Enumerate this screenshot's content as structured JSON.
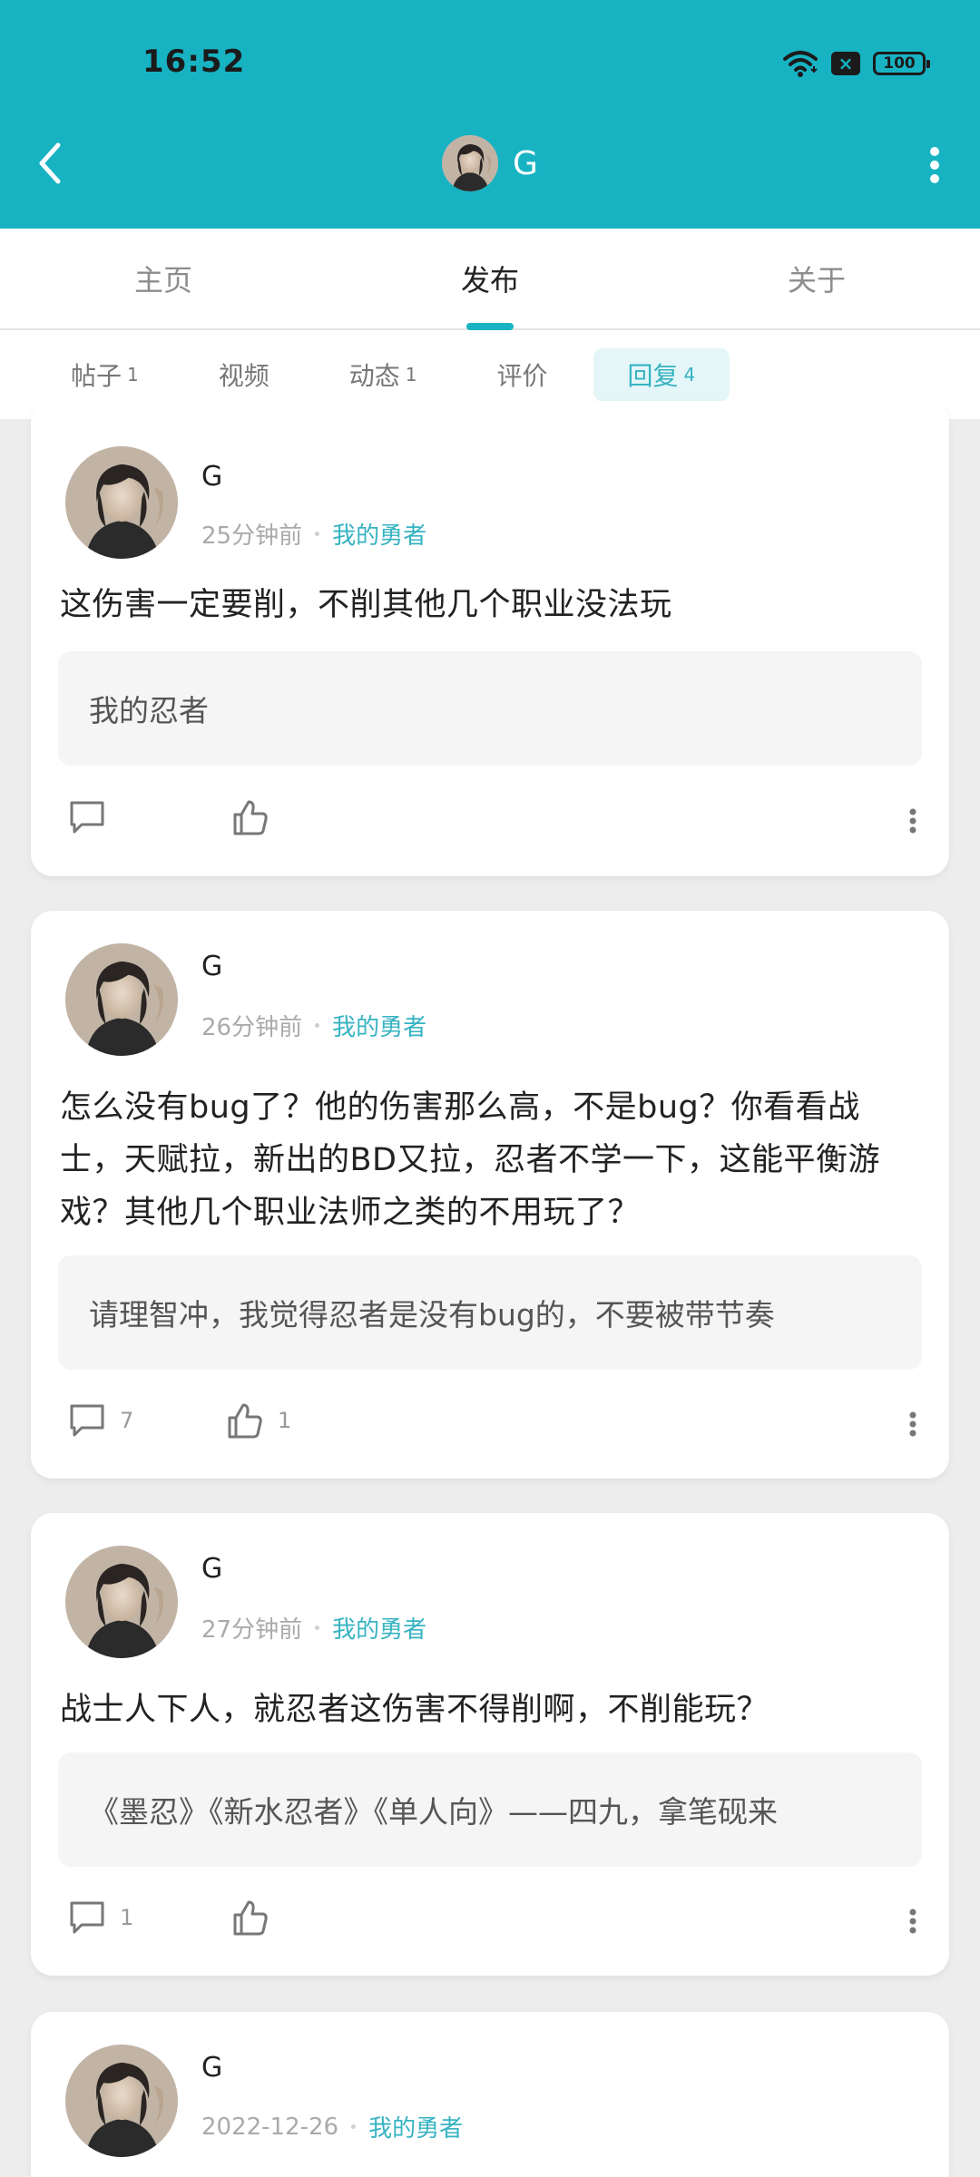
{
  "status_bar": {
    "time": "16:52",
    "battery": "100",
    "x_badge": "×"
  },
  "header": {
    "title": "G"
  },
  "tabs": [
    {
      "label": "主页"
    },
    {
      "label": "发布"
    },
    {
      "label": "关于"
    }
  ],
  "active_tab": "发布",
  "subtabs": [
    {
      "label": "帖子",
      "count": "1"
    },
    {
      "label": "视频",
      "count": ""
    },
    {
      "label": "动态",
      "count": "1"
    },
    {
      "label": "评价",
      "count": ""
    },
    {
      "label": "回复",
      "count": "4"
    }
  ],
  "active_subtab": "回复",
  "colors": {
    "accent": "#17b3c3",
    "accent_text": "#36b3c2"
  },
  "posts": [
    {
      "name": "G",
      "time": "25分钟前",
      "game": "我的勇者",
      "content": "这伤害一定要削，不削其他几个职业没法玩",
      "quote": "我的忍者",
      "comments": "",
      "likes": ""
    },
    {
      "name": "G",
      "time": "26分钟前",
      "game": "我的勇者",
      "content": "怎么没有bug了？他的伤害那么高，不是bug？你看看战士，天赋拉，新出的BD又拉，忍者不学一下，这能平衡游戏？其他几个职业法师之类的不用玩了？",
      "quote": "请理智冲，我觉得忍者是没有bug的，不要被带节奏",
      "comments": "7",
      "likes": "1"
    },
    {
      "name": "G",
      "time": "27分钟前",
      "game": "我的勇者",
      "content": "战士人下人，就忍者这伤害不得削啊，不削能玩？",
      "quote": "《墨忍》《新水忍者》《单人向》——四九，拿笔砚来",
      "comments": "1",
      "likes": ""
    },
    {
      "name": "G",
      "time": "2022-12-26",
      "game": "我的勇者"
    }
  ]
}
